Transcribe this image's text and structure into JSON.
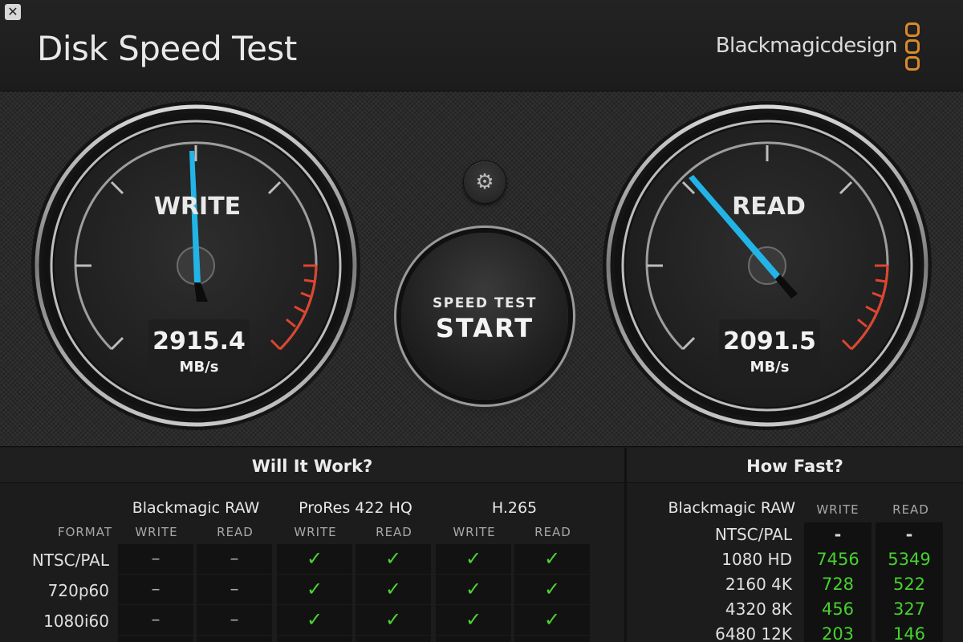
{
  "app": {
    "title": "Disk Speed Test",
    "brand": "Blackmagicdesign",
    "close_glyph": "✕"
  },
  "colors": {
    "accent_needle": "#22b4e6",
    "redline": "#e0442e",
    "check": "#4cd432",
    "logo_orange": "#d98a2b"
  },
  "write_gauge": {
    "label": "WRITE",
    "value": "2915.4",
    "unit": "MB/s"
  },
  "read_gauge": {
    "label": "READ",
    "value": "2091.5",
    "unit": "MB/s"
  },
  "settings": {
    "icon": "gear-icon",
    "glyph": "⚙"
  },
  "start_button": {
    "line1": "SPEED TEST",
    "line2": "START"
  },
  "will_it_work": {
    "title": "Will It Work?",
    "format_header": "FORMAT",
    "groups": [
      {
        "name": "Blackmagic RAW",
        "cols": [
          "WRITE",
          "READ"
        ]
      },
      {
        "name": "ProRes 422 HQ",
        "cols": [
          "WRITE",
          "READ"
        ]
      },
      {
        "name": "H.265",
        "cols": [
          "WRITE",
          "READ"
        ]
      }
    ],
    "rows": [
      {
        "format": "NTSC/PAL",
        "cells": [
          "–",
          "–",
          "✓",
          "✓",
          "✓",
          "✓"
        ]
      },
      {
        "format": "720p60",
        "cells": [
          "–",
          "–",
          "✓",
          "✓",
          "✓",
          "✓"
        ]
      },
      {
        "format": "1080i60",
        "cells": [
          "–",
          "–",
          "✓",
          "✓",
          "✓",
          "✓"
        ]
      }
    ]
  },
  "how_fast": {
    "title": "How Fast?",
    "codec": "Blackmagic RAW",
    "col_write": "WRITE",
    "col_read": "READ",
    "rows": [
      {
        "format": "NTSC/PAL",
        "write": "-",
        "read": "-"
      },
      {
        "format": "1080 HD",
        "write": "7456",
        "read": "5349"
      },
      {
        "format": "2160 4K",
        "write": "728",
        "read": "522"
      },
      {
        "format": "4320 8K",
        "write": "456",
        "read": "327"
      },
      {
        "format": "6480 12K",
        "write": "203",
        "read": "146"
      }
    ]
  }
}
